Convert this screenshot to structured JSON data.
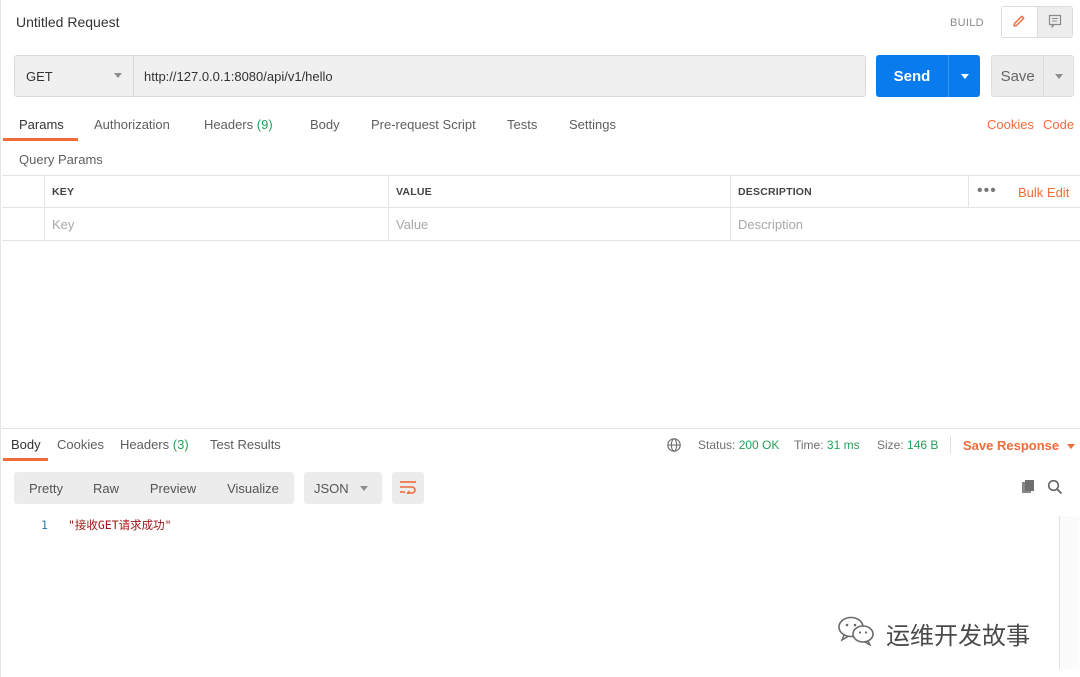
{
  "header": {
    "title": "Untitled Request",
    "build_label": "BUILD",
    "modes": [
      {
        "icon": "pencil-icon",
        "active": true
      },
      {
        "icon": "comment-icon",
        "active": false
      }
    ]
  },
  "request": {
    "method": "GET",
    "url": "http://127.0.0.1:8080/api/v1/hello",
    "send_label": "Send",
    "save_label": "Save"
  },
  "request_tabs": {
    "params": "Params",
    "authorization": "Authorization",
    "headers": "Headers",
    "headers_count": "(9)",
    "body": "Body",
    "prerequest": "Pre-request Script",
    "tests": "Tests",
    "settings": "Settings",
    "cookies_link": "Cookies",
    "code_link": "Code"
  },
  "params": {
    "section_label": "Query Params",
    "columns": {
      "key": "KEY",
      "value": "VALUE",
      "description": "DESCRIPTION"
    },
    "placeholders": {
      "key": "Key",
      "value": "Value",
      "description": "Description"
    },
    "more": "•••",
    "bulk_edit": "Bulk Edit"
  },
  "response": {
    "tabs": {
      "body": "Body",
      "cookies": "Cookies",
      "headers": "Headers",
      "headers_count": "(3)",
      "test_results": "Test Results"
    },
    "status_label": "Status:",
    "status_value": "200 OK",
    "time_label": "Time:",
    "time_value": "31 ms",
    "size_label": "Size:",
    "size_value": "146 B",
    "save_response": "Save Response",
    "views": [
      "Pretty",
      "Raw",
      "Preview",
      "Visualize"
    ],
    "format": "JSON",
    "lines": [
      {
        "num": "1",
        "text": "\"接收GET请求成功\""
      }
    ]
  },
  "watermark": {
    "text": "运维开发故事"
  },
  "colors": {
    "accent": "#f26b3a",
    "send": "#097bed",
    "success": "#26a05a"
  }
}
